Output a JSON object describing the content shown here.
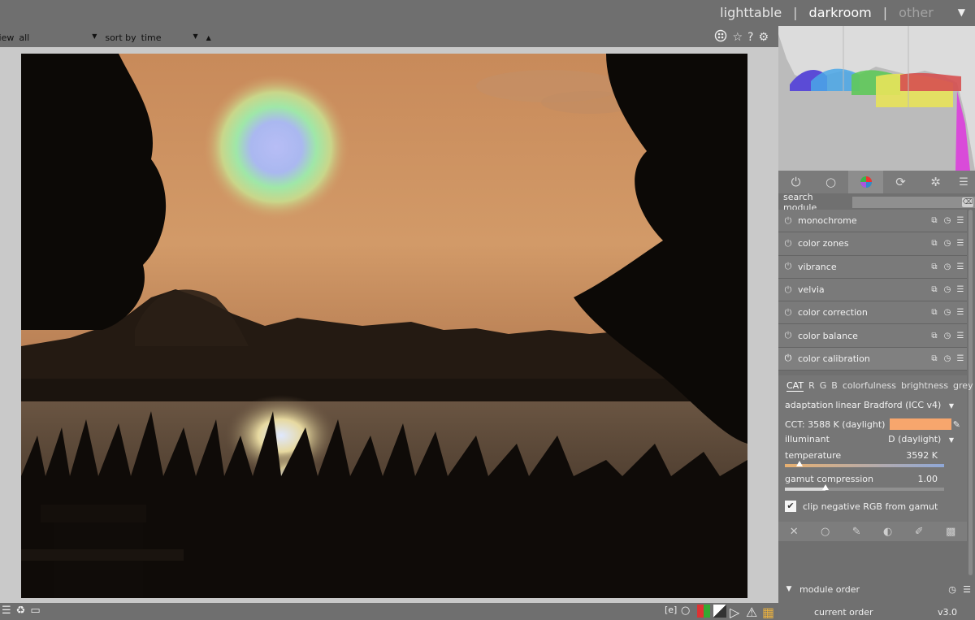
{
  "views": {
    "lighttable": "lighttable",
    "darkroom": "darkroom",
    "other": "other",
    "separator": "|"
  },
  "filterbar": {
    "view_label": "view",
    "view_value": "all",
    "sort_label": "sort by",
    "sort_value": "time",
    "sort_direction": "▲"
  },
  "top_icons": [
    "color-picker-icon",
    "star-icon",
    "help-icon",
    "gear-icon"
  ],
  "groups": [
    "power-icon",
    "circle-icon",
    "color-wheel-icon",
    "correct-icon",
    "effect-icon",
    "menu-icon"
  ],
  "search": {
    "label": "search module",
    "value": ""
  },
  "modules": [
    {
      "name": "monochrome",
      "enabled": false
    },
    {
      "name": "color zones",
      "enabled": false
    },
    {
      "name": "vibrance",
      "enabled": false
    },
    {
      "name": "velvia",
      "enabled": false
    },
    {
      "name": "color correction",
      "enabled": false
    },
    {
      "name": "color balance",
      "enabled": false
    },
    {
      "name": "color calibration",
      "enabled": true
    }
  ],
  "color_calibration": {
    "tabs": [
      "CAT",
      "R",
      "G",
      "B",
      "colorfulness",
      "brightness",
      "grey"
    ],
    "active_tab": "CAT",
    "adaptation_label": "adaptation",
    "adaptation_value": "linear Bradford (ICC v4)",
    "cct_label": "CCT: 3588 K (daylight)",
    "cct_swatch_color": "#f7a66d",
    "illuminant_label": "illuminant",
    "illuminant_value": "D (daylight)",
    "temperature_label": "temperature",
    "temperature_value": "3592 K",
    "gamut_label": "gamut compression",
    "gamut_value": "1.00",
    "clip_label": "clip negative RGB from gamut",
    "clip_checked": true
  },
  "mask_icons": [
    "off-icon",
    "uniform-icon",
    "drawn-icon",
    "parametric-icon",
    "drawn-parametric-icon",
    "raster-icon"
  ],
  "module_order": {
    "label": "module order",
    "current_label": "current order",
    "current_value": "v3.0"
  },
  "bottom_left_icons": [
    "presets-icon",
    "styles-icon",
    "second-window-icon"
  ],
  "bottom_right_icons": [
    "raw-overexposed-icon",
    "bulb-icon",
    "color-assessment-icon",
    "softproof-icon",
    "gamut-check-icon",
    "warning-icon",
    "guides-icon"
  ]
}
